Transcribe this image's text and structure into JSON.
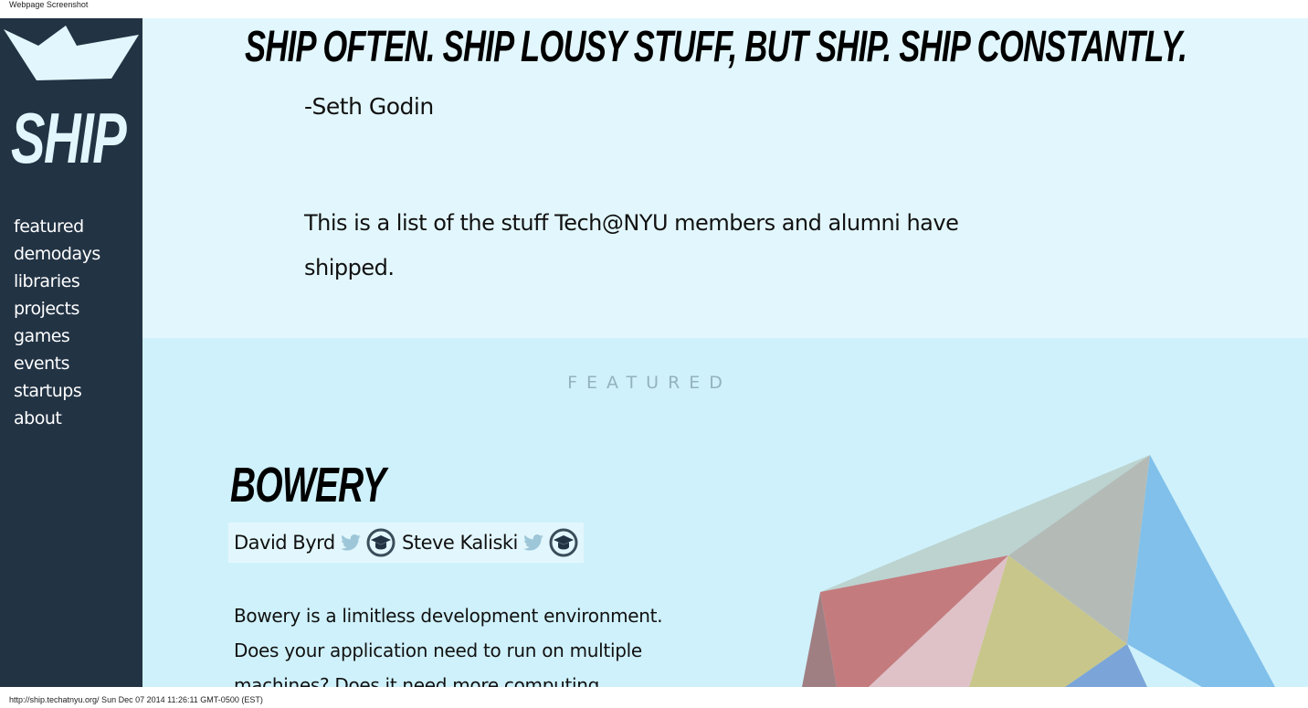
{
  "browser": {
    "top_caption": "Webpage Screenshot",
    "bottom_caption": "http://ship.techatnyu.org/ Sun Dec 07 2014 11:26:11 GMT-0500 (EST)"
  },
  "sidebar": {
    "logo_text": "SHIP",
    "nav": [
      "featured",
      "demodays",
      "libraries",
      "projects",
      "games",
      "events",
      "startups",
      "about"
    ]
  },
  "hero": {
    "quote": "SHIP OFTEN. SHIP LOUSY STUFF, BUT SHIP. SHIP CONSTANTLY.",
    "author": "-Seth Godin",
    "intro": "This is a list of the stuff Tech@NYU members and alumni have shipped."
  },
  "featured": {
    "heading": "FEATURED",
    "project": {
      "title": "BOWERY",
      "members": [
        {
          "name": "David Byrd",
          "icons": [
            "twitter-icon",
            "graduation-cap-icon"
          ]
        },
        {
          "name": "Steve Kaliski",
          "icons": [
            "twitter-icon",
            "graduation-cap-icon"
          ]
        }
      ],
      "description": "Bowery is a limitless development environment. Does your application need to run on multiple machines? Does it need more computing"
    }
  },
  "colors": {
    "sidebar_bg": "#223344",
    "hero_bg": "#e2f7fd",
    "featured_bg": "#cff1fb",
    "featured_heading": "#93b3bd"
  }
}
